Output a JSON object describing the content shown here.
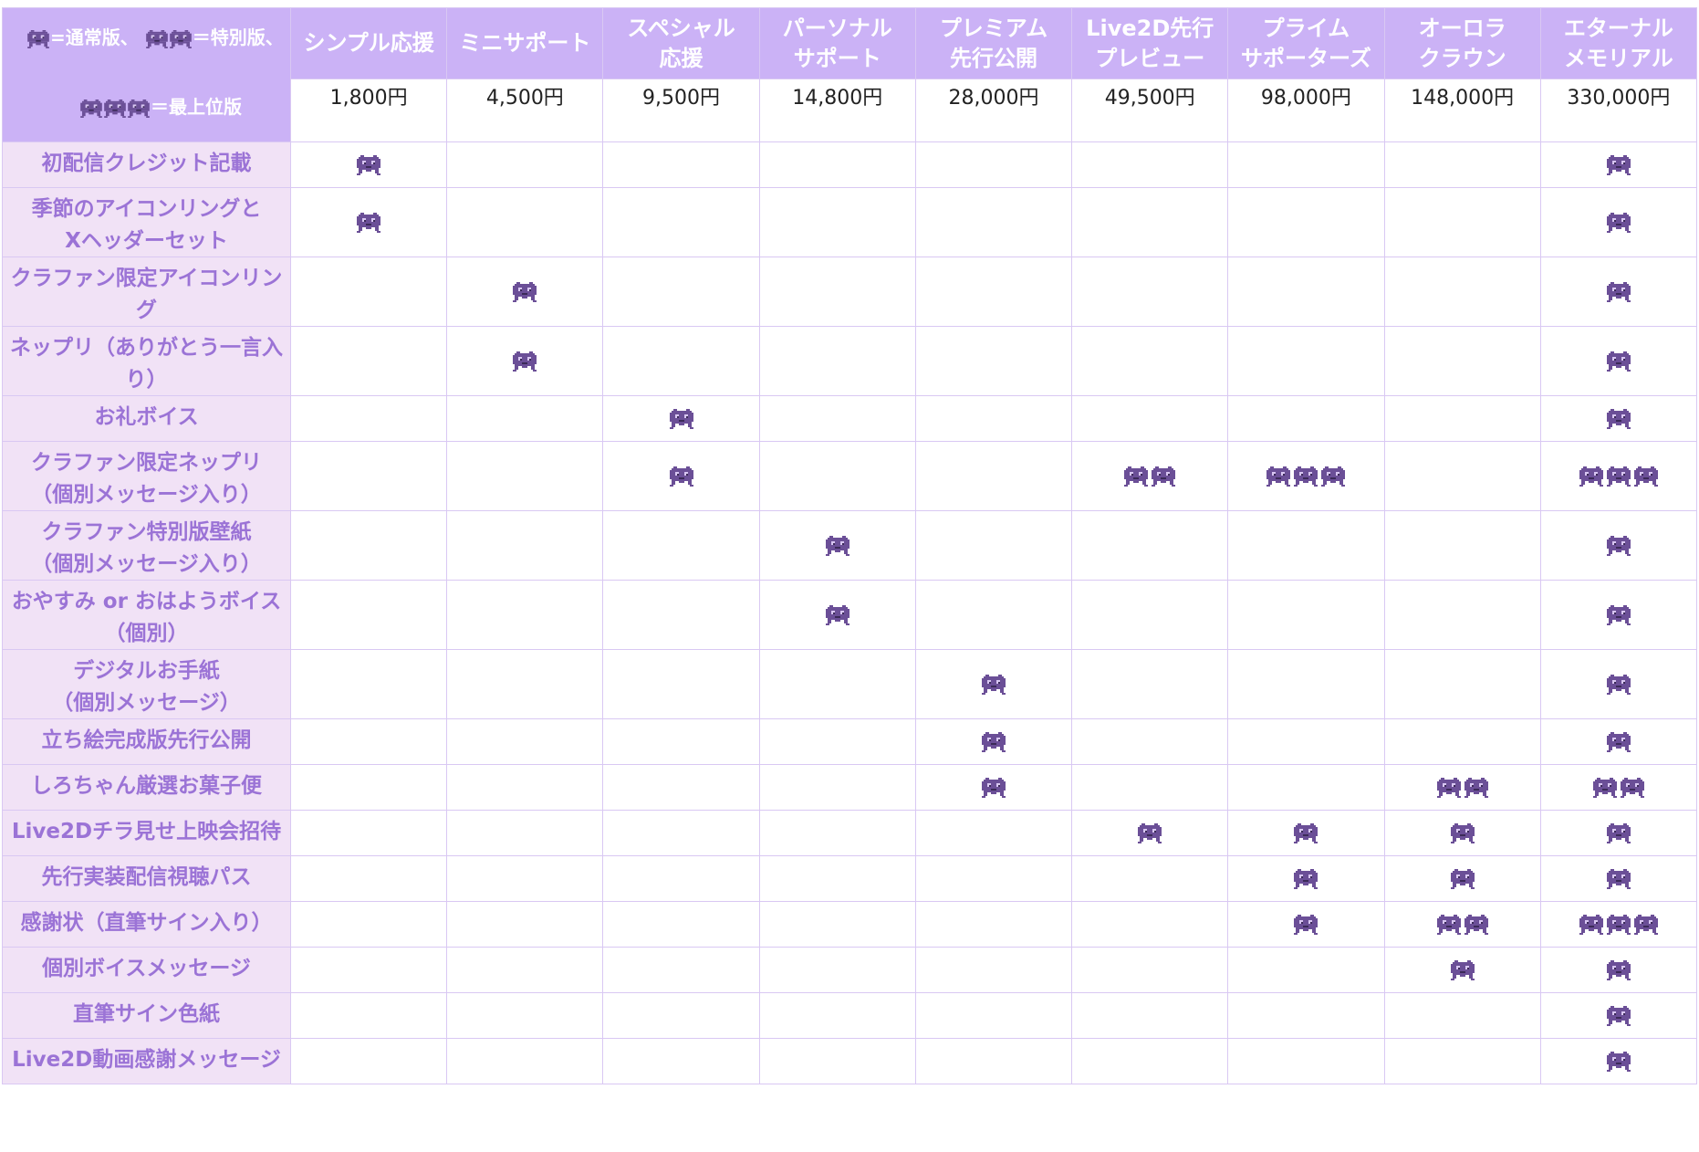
{
  "legend": {
    "normal_label": "=通常版、",
    "special_label": "＝特別版、",
    "top_label": "＝最上位版"
  },
  "tiers": [
    {
      "name_lines": [
        "シンプル応援"
      ],
      "price": "1,800円"
    },
    {
      "name_lines": [
        "ミニサポート"
      ],
      "price": "4,500円"
    },
    {
      "name_lines": [
        "スペシャル",
        "応援"
      ],
      "price": "9,500円"
    },
    {
      "name_lines": [
        "パーソナル",
        "サポート"
      ],
      "price": "14,800円"
    },
    {
      "name_lines": [
        "プレミアム",
        "先行公開"
      ],
      "price": "28,000円"
    },
    {
      "name_lines": [
        "Live2D先行",
        "プレビュー"
      ],
      "price": "49,500円"
    },
    {
      "name_lines": [
        "プライム",
        "サポーターズ"
      ],
      "price": "98,000円"
    },
    {
      "name_lines": [
        "オーロラ",
        "クラウン"
      ],
      "price": "148,000円"
    },
    {
      "name_lines": [
        "エターナル",
        "メモリアル"
      ],
      "price": "330,000円"
    }
  ],
  "rows": [
    {
      "label_lines": [
        "初配信クレジット記載"
      ],
      "marks": [
        1,
        0,
        0,
        0,
        0,
        0,
        0,
        0,
        1
      ]
    },
    {
      "label_lines": [
        "季節のアイコンリングと",
        "Xヘッダーセット"
      ],
      "marks": [
        1,
        0,
        0,
        0,
        0,
        0,
        0,
        0,
        1
      ]
    },
    {
      "label_lines": [
        "クラファン限定アイコンリング"
      ],
      "marks": [
        0,
        1,
        0,
        0,
        0,
        0,
        0,
        0,
        1
      ]
    },
    {
      "label_lines": [
        "ネップリ（ありがとう一言入り）"
      ],
      "marks": [
        0,
        1,
        0,
        0,
        0,
        0,
        0,
        0,
        1
      ]
    },
    {
      "label_lines": [
        "お礼ボイス"
      ],
      "marks": [
        0,
        0,
        1,
        0,
        0,
        0,
        0,
        0,
        1
      ]
    },
    {
      "label_lines": [
        "クラファン限定ネップリ",
        "（個別メッセージ入り）"
      ],
      "marks": [
        0,
        0,
        1,
        0,
        0,
        2,
        3,
        0,
        3
      ]
    },
    {
      "label_lines": [
        "クラファン特別版壁紙",
        "（個別メッセージ入り）"
      ],
      "marks": [
        0,
        0,
        0,
        1,
        0,
        0,
        0,
        0,
        1
      ]
    },
    {
      "label_lines": [
        "おやすみ or おはようボイス",
        "（個別）"
      ],
      "marks": [
        0,
        0,
        0,
        1,
        0,
        0,
        0,
        0,
        1
      ]
    },
    {
      "label_lines": [
        "デジタルお手紙",
        "（個別メッセージ）"
      ],
      "marks": [
        0,
        0,
        0,
        0,
        1,
        0,
        0,
        0,
        1
      ]
    },
    {
      "label_lines": [
        "立ち絵完成版先行公開"
      ],
      "marks": [
        0,
        0,
        0,
        0,
        1,
        0,
        0,
        0,
        1
      ]
    },
    {
      "label_lines": [
        "しろちゃん厳選お菓子便"
      ],
      "marks": [
        0,
        0,
        0,
        0,
        1,
        0,
        0,
        2,
        2
      ]
    },
    {
      "label_lines": [
        "Live2Dチラ見せ上映会招待"
      ],
      "marks": [
        0,
        0,
        0,
        0,
        0,
        1,
        1,
        1,
        1
      ]
    },
    {
      "label_lines": [
        "先行実装配信視聴パス"
      ],
      "marks": [
        0,
        0,
        0,
        0,
        0,
        0,
        1,
        1,
        1
      ]
    },
    {
      "label_lines": [
        "感謝状（直筆サイン入り）"
      ],
      "marks": [
        0,
        0,
        0,
        0,
        0,
        0,
        1,
        2,
        3
      ]
    },
    {
      "label_lines": [
        "個別ボイスメッセージ"
      ],
      "marks": [
        0,
        0,
        0,
        0,
        0,
        0,
        0,
        1,
        1
      ]
    },
    {
      "label_lines": [
        "直筆サイン色紙"
      ],
      "marks": [
        0,
        0,
        0,
        0,
        0,
        0,
        0,
        0,
        1
      ]
    },
    {
      "label_lines": [
        "Live2D動画感謝メッセージ"
      ],
      "marks": [
        0,
        0,
        0,
        0,
        0,
        0,
        0,
        0,
        1
      ]
    }
  ],
  "icon": {
    "name": "pixel-creature-icon",
    "color": "#6b4f97"
  }
}
